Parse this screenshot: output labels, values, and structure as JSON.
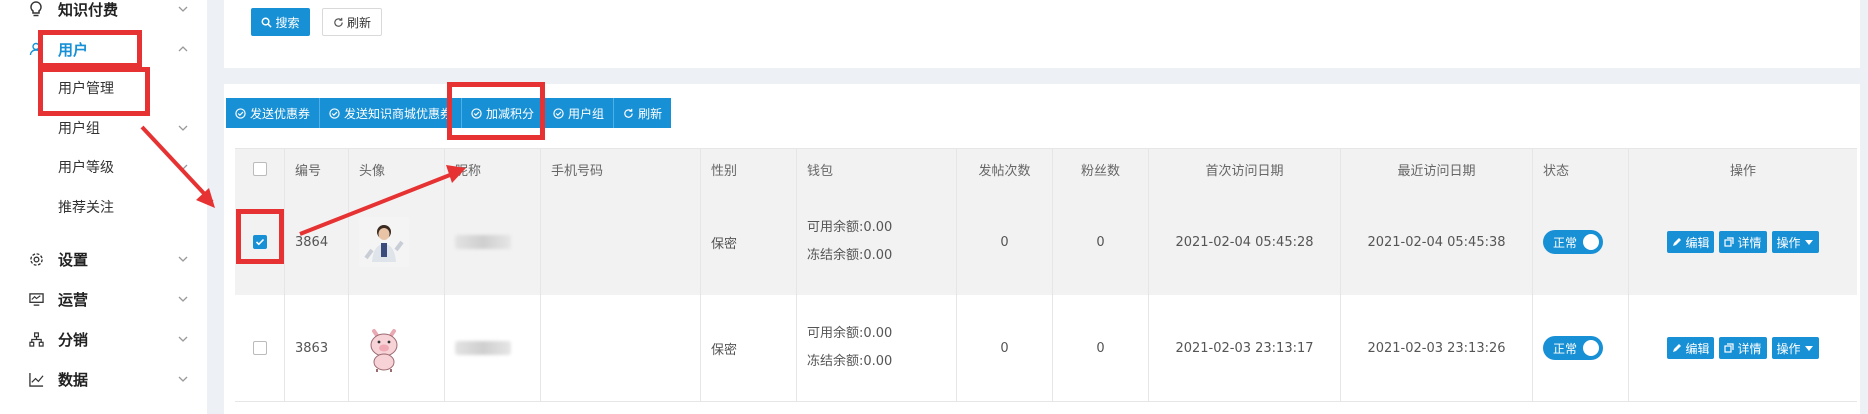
{
  "sidebar": {
    "items": [
      {
        "label": "知识付费",
        "icon": "lightbulb-icon",
        "type": "group"
      },
      {
        "label": "用户",
        "icon": "user-icon",
        "type": "group-open"
      },
      {
        "label": "用户管理",
        "type": "sub"
      },
      {
        "label": "用户组",
        "type": "sub-chev"
      },
      {
        "label": "用户等级",
        "type": "sub-chev"
      },
      {
        "label": "推荐关注",
        "type": "sub"
      },
      {
        "label": "设置",
        "icon": "gear-icon",
        "type": "group"
      },
      {
        "label": "运营",
        "icon": "monitor-icon",
        "type": "group"
      },
      {
        "label": "分销",
        "icon": "hierarchy-icon",
        "type": "group"
      },
      {
        "label": "数据",
        "icon": "chart-icon",
        "type": "group"
      }
    ]
  },
  "search": {
    "search_label": "搜索",
    "refresh_label": "刷新"
  },
  "toolbar": {
    "buttons": [
      {
        "label": "发送优惠券"
      },
      {
        "label": "发送知识商城优惠券"
      },
      {
        "label": "加减积分"
      },
      {
        "label": "用户组"
      },
      {
        "label": "刷新"
      }
    ]
  },
  "table": {
    "columns": [
      "编号",
      "头像",
      "昵称",
      "手机号码",
      "性别",
      "钱包",
      "发帖次数",
      "粉丝数",
      "首次访问日期",
      "最近访问日期",
      "状态",
      "操作"
    ],
    "rows": [
      {
        "id": "3864",
        "checked": true,
        "gender": "保密",
        "wallet_available": "可用余额:0.00",
        "wallet_frozen": "冻结余额:0.00",
        "posts": "0",
        "fans": "0",
        "first_visit": "2021-02-04 05:45:28",
        "last_visit": "2021-02-04 05:45:38",
        "status": "正常",
        "avatar": "person-photo"
      },
      {
        "id": "3863",
        "checked": false,
        "gender": "保密",
        "wallet_available": "可用余额:0.00",
        "wallet_frozen": "冻结余额:0.00",
        "posts": "0",
        "fans": "0",
        "first_visit": "2021-02-03 23:13:17",
        "last_visit": "2021-02-03 23:13:26",
        "status": "正常",
        "avatar": "pig-cartoon"
      }
    ],
    "ops": {
      "edit": "编辑",
      "detail": "详情",
      "more": "操作"
    }
  },
  "colors": {
    "primary": "#1890d5",
    "annotation": "#e63232"
  }
}
